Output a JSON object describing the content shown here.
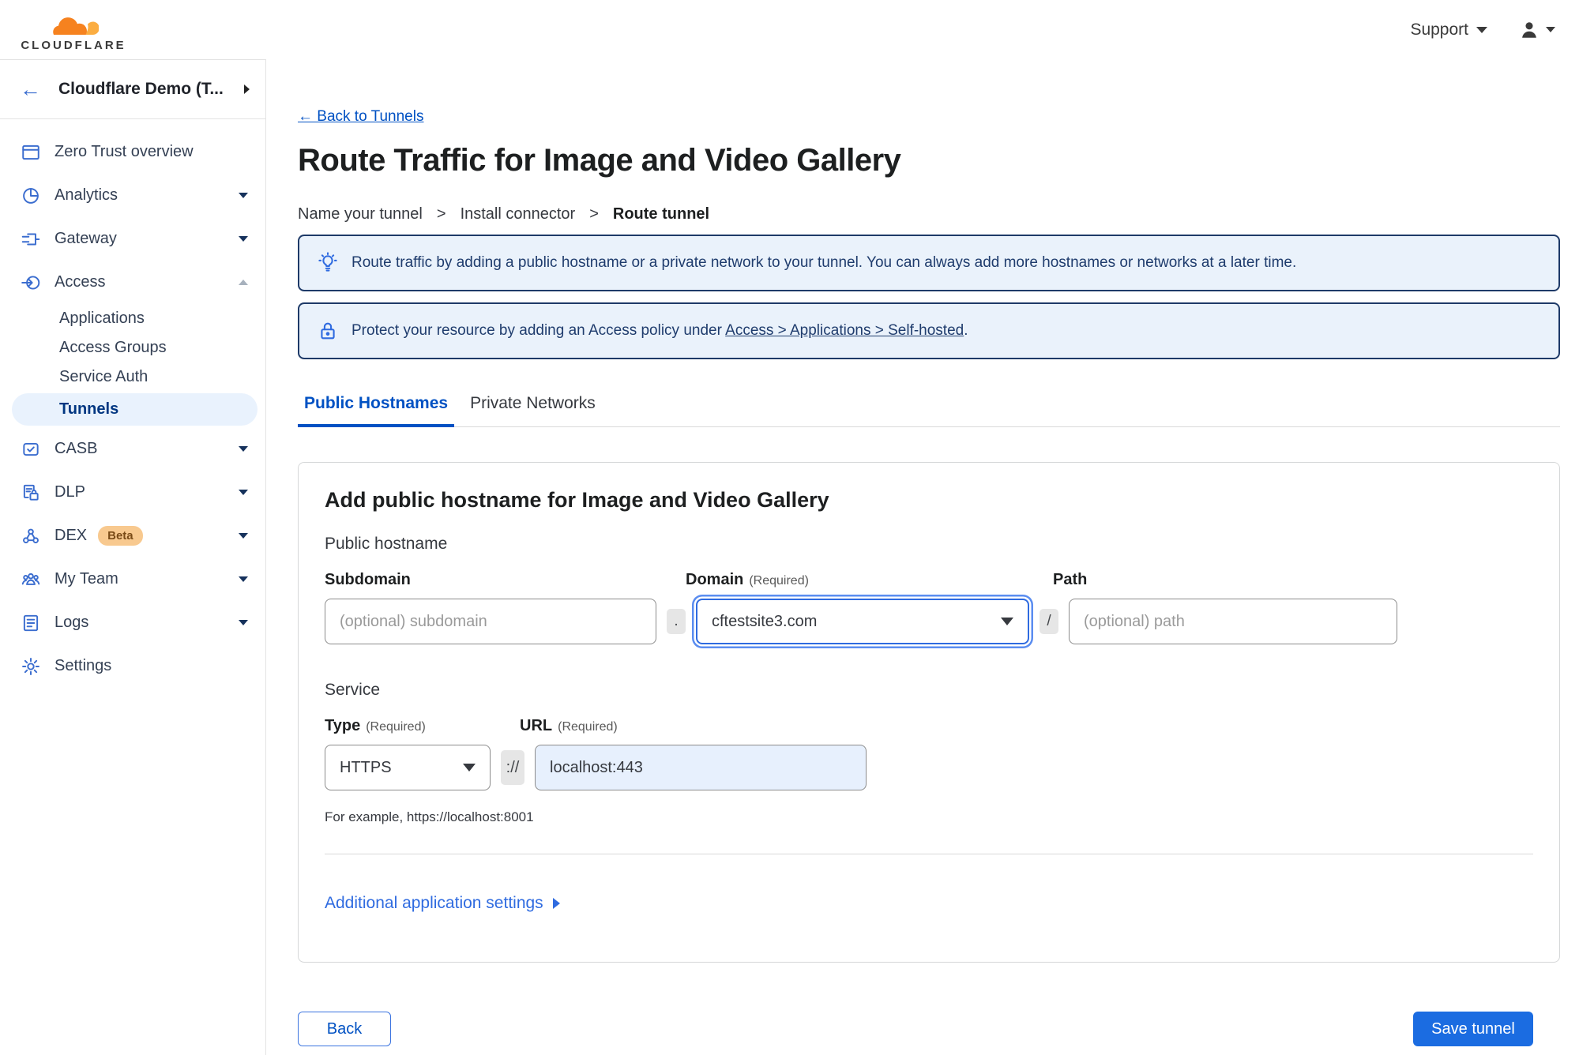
{
  "logo": {
    "wordmark": "CLOUDFLARE"
  },
  "topbar": {
    "support_label": "Support"
  },
  "sidebar": {
    "account_label": "Cloudflare Demo (T...",
    "back_arrow": "←",
    "items": [
      {
        "label": "Zero Trust overview",
        "icon": "window-icon",
        "chevron": "none"
      },
      {
        "label": "Analytics",
        "icon": "pie-chart-icon",
        "chevron": "down"
      },
      {
        "label": "Gateway",
        "icon": "gateway-icon",
        "chevron": "down"
      },
      {
        "label": "Access",
        "icon": "access-icon",
        "chevron": "up",
        "expanded": true
      },
      {
        "label": "CASB",
        "icon": "casb-icon",
        "chevron": "down"
      },
      {
        "label": "DLP",
        "icon": "dlp-icon",
        "chevron": "down"
      },
      {
        "label": "DEX",
        "icon": "dex-icon",
        "chevron": "down",
        "badge": "Beta"
      },
      {
        "label": "My Team",
        "icon": "team-icon",
        "chevron": "down"
      },
      {
        "label": "Logs",
        "icon": "logs-icon",
        "chevron": "down"
      },
      {
        "label": "Settings",
        "icon": "gear-icon",
        "chevron": "none"
      }
    ],
    "access_subitems": [
      {
        "label": "Applications",
        "active": false
      },
      {
        "label": "Access Groups",
        "active": false
      },
      {
        "label": "Service Auth",
        "active": false
      },
      {
        "label": "Tunnels",
        "active": true
      }
    ]
  },
  "main": {
    "back_link": "← Back to Tunnels",
    "title": "Route Traffic for Image and Video Gallery",
    "breadcrumb": {
      "steps": [
        "Name your tunnel",
        "Install connector",
        "Route tunnel"
      ],
      "separator": ">"
    },
    "banners": [
      {
        "icon": "lightbulb-icon",
        "text": "Route traffic by adding a public hostname or a private network to your tunnel. You can always add more hostnames or networks at a later time."
      },
      {
        "icon": "lock-icon",
        "text_prefix": "Protect your resource by adding an Access policy under ",
        "link_text": "Access > Applications > Self-hosted",
        "text_suffix": "."
      }
    ],
    "tabs": [
      {
        "label": "Public Hostnames",
        "active": true
      },
      {
        "label": "Private Networks",
        "active": false
      }
    ],
    "form": {
      "heading": "Add public hostname for Image and Video Gallery",
      "section_public_hostname": "Public hostname",
      "required_label": "(Required)",
      "subdomain_label": "Subdomain",
      "subdomain_placeholder": "(optional) subdomain",
      "dot_separator": ".",
      "domain_label": "Domain",
      "domain_value": "cftestsite3.com",
      "slash_separator": "/",
      "path_label": "Path",
      "path_placeholder": "(optional) path",
      "section_service": "Service",
      "type_label": "Type",
      "type_value": "HTTPS",
      "scheme_separator": "://",
      "url_label": "URL",
      "url_value": "localhost:443",
      "example_text": "For example, https://localhost:8001",
      "additional_settings_label": "Additional application settings"
    },
    "footer": {
      "back_label": "Back",
      "save_label": "Save tunnel"
    }
  },
  "colors": {
    "link_blue": "#0051c3",
    "button_blue": "#1b6ce1",
    "sidebar_icon_blue": "#3b6dcf",
    "active_nav_text": "#003681",
    "active_nav_bg": "#e9f2fd",
    "banner_bg": "#eaf2fb",
    "banner_border": "#1e3a68",
    "banner_text": "#1f3c6d",
    "beta_badge_bg": "#f8c98f",
    "beta_badge_text": "#7a4b17",
    "url_field_bg": "#e7f0fd",
    "focus_ring_blue": "#2f6be0",
    "logo_orange": "#f6821f",
    "logo_light_orange": "#fbad41"
  }
}
